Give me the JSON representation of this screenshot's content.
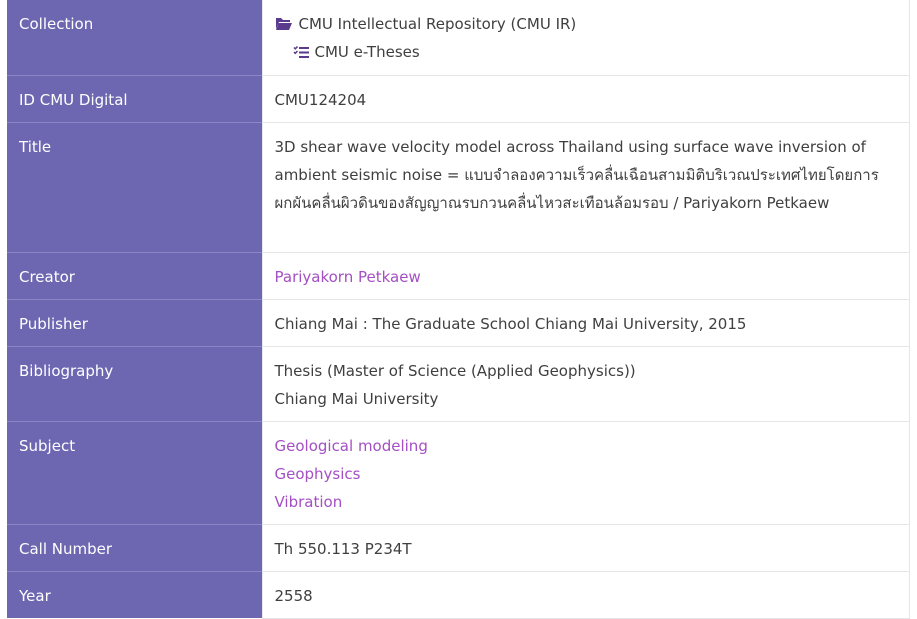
{
  "rows": {
    "collection": {
      "label": "Collection",
      "items": [
        {
          "text": "CMU Intellectual Repository (CMU IR)",
          "icon": "folder-open-icon"
        },
        {
          "text": "CMU e-Theses",
          "icon": "task-list-icon"
        }
      ]
    },
    "id": {
      "label": "ID CMU Digital",
      "value": "CMU124204"
    },
    "title": {
      "label": "Title",
      "value": "3D shear wave velocity model across Thailand using surface wave inversion of ambient seismic noise = แบบจำลองความเร็วคลื่นเฉือนสามมิติบริเวณประเทศไทยโดยการผกผันคลื่นผิวดินของสัญญาณรบกวนคลื่นไหวสะเทือนล้อมรอบ / Pariyakorn Petkaew"
    },
    "creator": {
      "label": "Creator",
      "value": "Pariyakorn Petkaew"
    },
    "publisher": {
      "label": "Publisher",
      "value": "Chiang Mai : The Graduate School Chiang Mai University, 2015"
    },
    "bibliography": {
      "label": "Bibliography",
      "lines": [
        "Thesis (Master of Science (Applied Geophysics))",
        "Chiang Mai University"
      ]
    },
    "subject": {
      "label": "Subject",
      "items": [
        "Geological modeling",
        "Geophysics",
        "Vibration"
      ]
    },
    "call_number": {
      "label": "Call Number",
      "value": "Th 550.113 P234T"
    },
    "year": {
      "label": "Year",
      "value": "2558"
    }
  },
  "colors": {
    "label_bg": "#6d67b1",
    "link": "#a44fc3",
    "text": "#3f3f3f"
  }
}
